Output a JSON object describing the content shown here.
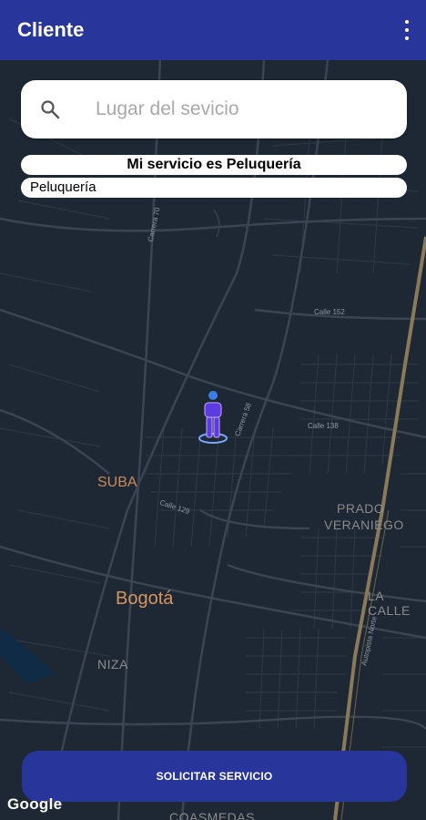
{
  "appbar": {
    "title": "Cliente",
    "menu_icon": "more-vert-icon"
  },
  "search": {
    "placeholder": "Lugar del sevicio",
    "icon": "search-icon"
  },
  "service": {
    "title": "Mi servicio es Peluquería",
    "selected": "Peluquería"
  },
  "map": {
    "labels": {
      "suba": "SUBA",
      "bogota": "Bogotá",
      "prado": "PRADO",
      "veraniego": "VERANIEGO",
      "la_calle": "LA CALLE",
      "niza": "NIZA",
      "coasmedas": "COASMEDAS",
      "calle_152": "Calle 152",
      "calle_138": "Calle 138",
      "calle_129": "Calle 129",
      "carrera_58": "Carrera 58",
      "carrera_70": "Carrera 70",
      "autopista_norte": "Autopista Norte"
    },
    "marker_icon": "person-location-icon"
  },
  "actions": {
    "request_label": "SOLICITAR SERVICIO"
  },
  "attribution": {
    "google": "Google"
  },
  "colors": {
    "appbar": "#28359a",
    "map_background": "#1e2834",
    "map_road": "#36414f",
    "highway": "#8a7a5a",
    "place_label": "#d5945f",
    "marker": "#5a3ce0"
  }
}
